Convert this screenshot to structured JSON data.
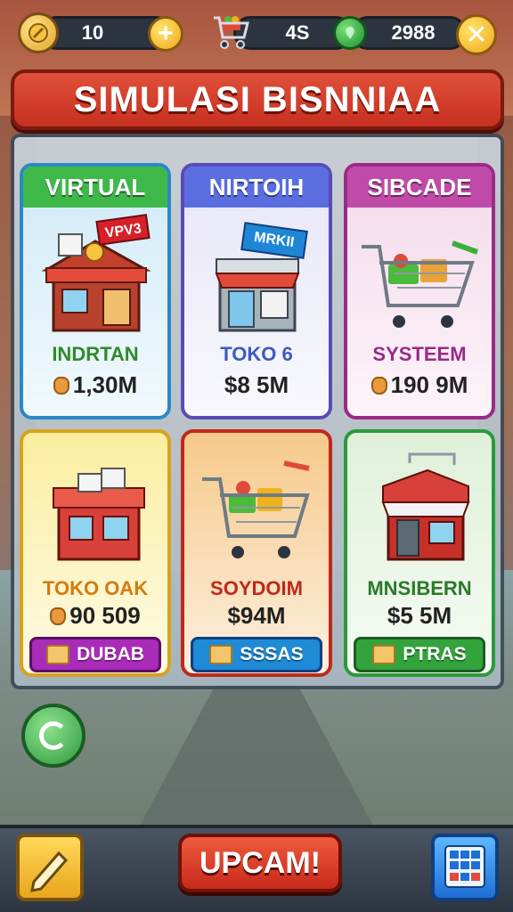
{
  "hud": {
    "level": "10",
    "cart_count": "4S",
    "gems": "2988"
  },
  "title": "SIMULASI BISNNIAA",
  "cards": [
    {
      "header": "VIRTUAL",
      "name": "INDRTAN",
      "price": "1,30M",
      "header_color": "#3fb84a",
      "border_color": "#2a88c8",
      "bg": "#cfeaf7",
      "name_color": "#2f8a2a",
      "has_money_icon": true,
      "sign": "VPV3"
    },
    {
      "header": "NIRTOIH",
      "name": "TOKO 6",
      "price": "$8 5M",
      "header_color": "#5a6ee0",
      "border_color": "#5a4ab8",
      "bg": "#e6e6f7",
      "name_color": "#3b5bbf",
      "has_money_icon": false,
      "sign": "MRKII"
    },
    {
      "header": "SIBCADE",
      "name": "SYSTEEM",
      "price": "190 9M",
      "header_color": "#c04aa8",
      "border_color": "#9a2a88",
      "bg": "#f4d9ea",
      "name_color": "#9a2a88",
      "has_money_icon": true,
      "sign": ""
    },
    {
      "header": "",
      "name": "TOKO OAK",
      "price": "90 509",
      "header_color": "",
      "border_color": "#d9a21a",
      "bg": "#fbeea0",
      "name_color": "#d47a10",
      "has_money_icon": true,
      "button": "DUBAB",
      "button_color": "#a92bb8"
    },
    {
      "header": "",
      "name": "SOYDOIM",
      "price": "$94M",
      "header_color": "",
      "border_color": "#c0281a",
      "bg": "#f6c98a",
      "name_color": "#c0281a",
      "has_money_icon": false,
      "button": "SSSAS",
      "button_color": "#1f8ad6"
    },
    {
      "header": "",
      "name": "MNSIBERN",
      "price": "$5 5M",
      "header_color": "",
      "border_color": "#2a9a3a",
      "bg": "#dff0d8",
      "name_color": "#2a7a2a",
      "has_money_icon": false,
      "button": "PTRAS",
      "button_color": "#33a43c"
    }
  ],
  "bottom": {
    "upgrade_label": "UPCAM!"
  },
  "icons": {
    "coin": "coin-icon",
    "plus": "plus-icon",
    "cart": "shopping-cart-icon",
    "gem": "gem-icon",
    "close": "close-icon",
    "refresh": "refresh-icon",
    "edit": "edit-icon",
    "grid": "grid-menu-icon"
  }
}
